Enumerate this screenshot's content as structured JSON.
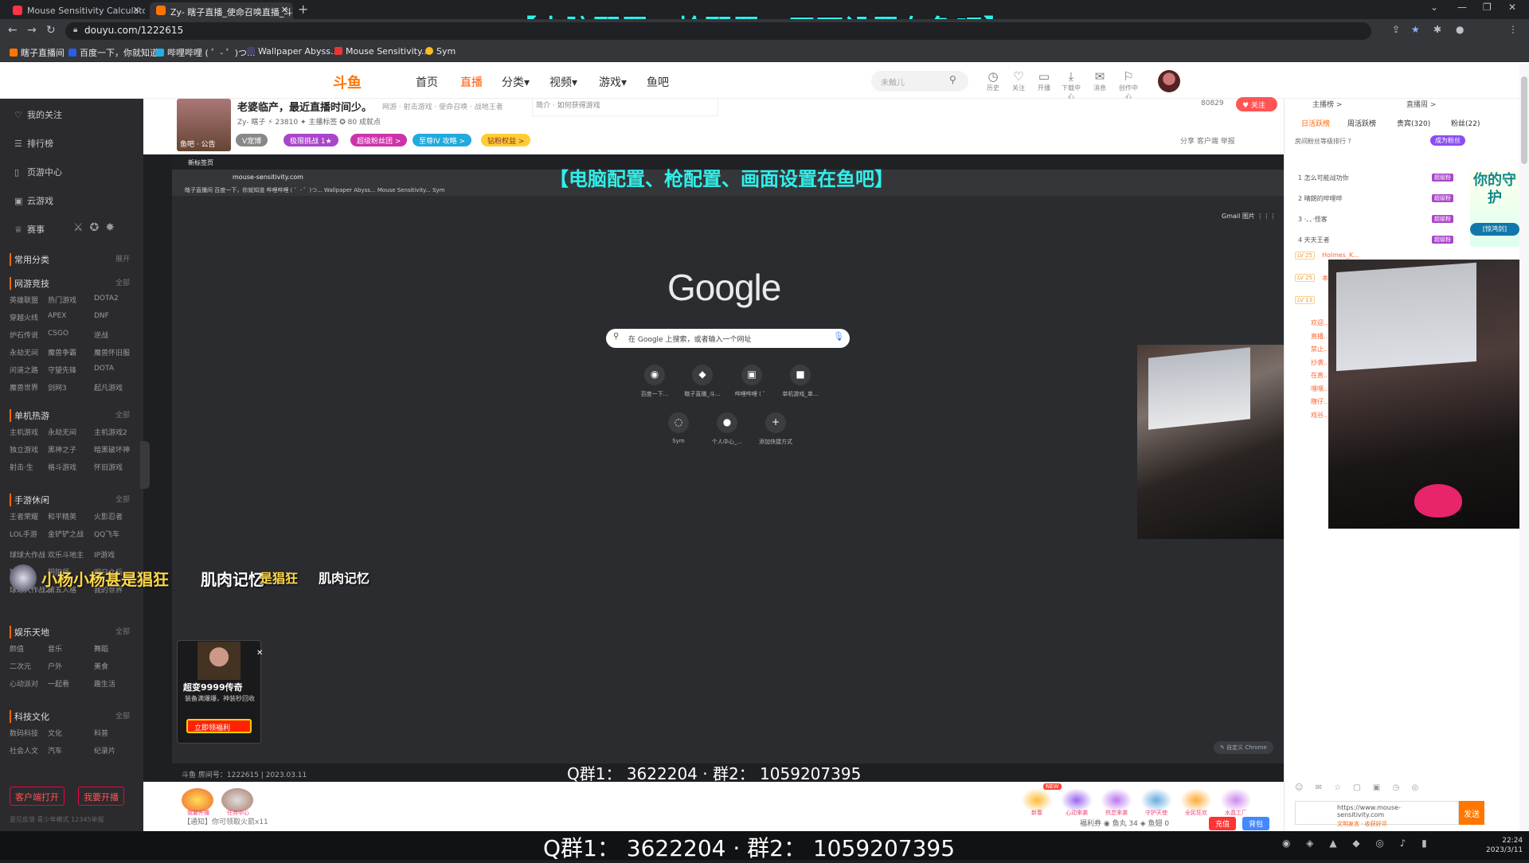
{
  "browser": {
    "tabs": [
      {
        "label": "Mouse Sensitivity Calculator a",
        "close": "✕"
      },
      {
        "label": "Zy- 瞎子直播_使命召唤直播_斗鱼",
        "close": "✕"
      }
    ],
    "new_tab": "+",
    "url": "douyu.com/1222615",
    "bookmarks": [
      "瞎子直播间",
      "百度一下，你就知道",
      "哔哩哔哩 ( ゜- ゜)つ...",
      "Wallpaper Abyss...",
      "Mouse Sensitivity...",
      "Sym"
    ]
  },
  "overlay": {
    "top_text": "【电脑配置、枪配置、画面设置在鱼吧】",
    "mid_text": "【电脑配置、枪配置、画面设置在鱼吧】",
    "qq_line_mid": "Q群1：   3622204  ·   群2：   1059207395",
    "qq_line_bottom": "Q群1：   3622204  ·   群2：   1059207395",
    "muscle_a": "小杨小杨甚是猖狂",
    "muscle_b": "肌肉记忆",
    "muscle_c": "是猖狂",
    "muscle_d": "肌肉记忆"
  },
  "douyu_header": {
    "logo": "斗鱼",
    "nav": [
      "首页",
      "直播",
      "分类▾",
      "视频▾",
      "游戏▾",
      "鱼吧"
    ],
    "search_placeholder": "未触儿",
    "icons": [
      {
        "name": "history-icon",
        "label": "历史"
      },
      {
        "name": "follow-icon",
        "label": "关注"
      },
      {
        "name": "broadcast-icon",
        "label": "开播"
      },
      {
        "name": "download-icon",
        "label": "下载中心"
      },
      {
        "name": "message-icon",
        "label": "消息"
      },
      {
        "name": "creator-icon",
        "label": "创作中心"
      }
    ]
  },
  "sidebar": {
    "items": [
      "我的关注",
      "排行榜",
      "页游中心",
      "云游戏",
      "赛事"
    ],
    "common_label": "常用分类",
    "common_more": "展开",
    "sections": [
      {
        "title": "网游竞技",
        "more": "全部",
        "games": [
          "英雄联盟",
          "热门游戏",
          "DOTA2",
          "穿越火线",
          "APEX",
          "DNF",
          "炉石传说",
          "CSGO",
          "逆战",
          "永劫无间",
          "魔兽争霸",
          "魔兽怀旧服",
          "问道之路",
          "守望先锋",
          "DOTA",
          "魔兽世界",
          "剑网3",
          "起凡游戏"
        ]
      },
      {
        "title": "单机热游",
        "more": "全部",
        "games": [
          "主机游戏",
          "永劫无间",
          "主机游戏2",
          "独立游戏",
          "黑神之子",
          "暗黑破坏神",
          "射击·生",
          "格斗游戏",
          "怀旧游戏"
        ]
      },
      {
        "title": "手游休闲",
        "more": "全部",
        "games": [
          "王者荣耀",
          "和平精英",
          "火影忍者",
          "LOL手游",
          "金铲铲之战",
          "QQ飞车"
        ]
      },
      {
        "title": "",
        "more": "",
        "games": [
          "球球大作战",
          "欢乐斗地主",
          "IP游戏",
          "狼人杀",
          "阴阳师",
          "明日之后",
          "球球大作战2",
          "第五人格",
          "我的世界"
        ]
      },
      {
        "title": "娱乐天地",
        "more": "全部",
        "games": [
          "颜值",
          "音乐",
          "舞蹈",
          "二次元",
          "户外",
          "美食",
          "心动派对",
          "一起看",
          "趣生活"
        ]
      },
      {
        "title": "科技文化",
        "more": "全部",
        "games": [
          "数码科技",
          "文化",
          "科普",
          "社会人文",
          "汽车",
          "纪录片"
        ]
      }
    ],
    "client_btn": "客户端打开",
    "live_btn": "我要开播",
    "footer": "意见反馈   青少年模式   12345举报"
  },
  "room": {
    "title": "老婆临产，最近直播时间少。",
    "crumb": "网游 · 射击游戏 · 使命召唤 · 战地王者",
    "meta": "Zy- 瞎子  ⚡ 23810  ✦ 主播标签  ✪ 80 成就点",
    "anchor_label": "鱼吧 · 公告",
    "tags": [
      "V宠博",
      "极限挑战 1★",
      "超级粉丝团 >",
      "至尊IV 攻略 >",
      "钻粉权益 >"
    ],
    "notice": "简介 · 如何获得游戏",
    "followers": "80829",
    "follow": "♥ 关注",
    "actions": "分享   客户端   举报"
  },
  "video": {
    "inner_tab": "新标签页",
    "inner_url": "mouse-sensitivity.com",
    "inner_bookmarks": "瞎子直播间   百度一下，你就知道   哔哩哔哩 ( ゜- ゜)つ...   Wallpaper Abyss...   Mouse Sensitivity...   Sym",
    "google": "Google",
    "gsearch_placeholder": "在 Google 上搜索，或者输入一个网址",
    "shortcuts": [
      {
        "label": "百度一下...",
        "glyph": "◉"
      },
      {
        "label": "瞎子直播_斗...",
        "glyph": "◆"
      },
      {
        "label": "哔哩哔哩 ( ゜",
        "glyph": "▣"
      },
      {
        "label": "单机游戏_单...",
        "glyph": "■"
      },
      {
        "label": "Sym",
        "glyph": "◌"
      },
      {
        "label": "个人中心_...",
        "glyph": "●"
      },
      {
        "label": "添加快捷方式",
        "glyph": "+"
      }
    ],
    "gmail": "Gmail   图片   ⋮⋮⋮",
    "customize": "✎ 自定义 Chrome",
    "room_id": "斗鱼 房间号：1222615 | 2023.03.11",
    "ad_title": "超变9999传奇",
    "ad_sub": "装备满爆爆，神装秒回收",
    "ad_btn": "立即领福利",
    "ad_close": "✕"
  },
  "gifts": {
    "labels": [
      "我要开播",
      "任务中心"
    ],
    "right_labels": [
      "新春",
      "心动来袭",
      "热恋来袭",
      "守护天使",
      "全民狂欢",
      "水晶工厂"
    ],
    "new_badge": "NEW",
    "notice": "【通知】你可领取火箭x11",
    "bottom_links": "福利券   ◉ 鱼丸 34   ◈ 鱼翅 0",
    "charge": "充值",
    "red": "背包"
  },
  "chat": {
    "top": [
      "主播榜 >",
      "直播周 >"
    ],
    "tabs": [
      "日活跃榜",
      "周活跃榜",
      "贵宾(320)",
      "粉丝(22)"
    ],
    "rank_hint": "房间粉丝等级排行 ?",
    "rank_btn": "成为粉丝",
    "ranks": [
      "1  怎么可能战功你",
      "2  晴朗的哔哩哔",
      "3  ·、、·怪客",
      "4  天天王者"
    ],
    "rank_badge": "超级粉",
    "levels": [
      "LV 25",
      "LV 25",
      "LV 13"
    ],
    "lines": [
      "Holmes_K...",
      "本打不死...",
      "欢迎...",
      "直播...",
      "禁止...",
      "抄袭...",
      "在直...",
      "嘿嘿...",
      "瞎仔...",
      "戏谷..."
    ],
    "guard": "你的守护",
    "guard_tag": "[惊鸿剑]",
    "input": "https://www.mouse-sensitivity.com",
    "input_sub": "文明发言 · 收获好评",
    "send": "发送",
    "tools": "☺ ✉ ☆ ▢ ▣ ◷ ◎"
  },
  "taskbar": {
    "clock_time": "22:24",
    "clock_date": "2023/3/11",
    "tray": "◉ ◈ ▲ ◆ ◎ ♪ ▮"
  }
}
